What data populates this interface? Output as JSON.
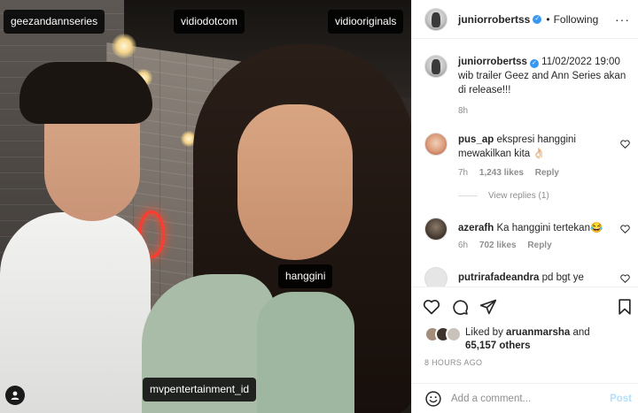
{
  "photo": {
    "tags": {
      "geezandannseries": "geezandannseries",
      "vidiodotcom": "vidiodotcom",
      "vidiooriginals": "vidiooriginals",
      "hanggini": "hanggini",
      "mvpentertainment": "mvpentertainment_id"
    },
    "user_tag_icon": "person-icon"
  },
  "header": {
    "username": "juniorrobertss",
    "separator": "•",
    "follow_label": "Following",
    "more_icon": "more-icon",
    "more_glyph": "···"
  },
  "caption": {
    "username": "juniorrobertss",
    "text": "11/02/2022 19:00 wib trailer Geez and Ann Series akan di release!!!",
    "time": "8h"
  },
  "comments": [
    {
      "username": "pus_ap",
      "text": "ekspresi hanggini mewakilkan kita 👌🏻",
      "time": "7h",
      "likes": "1,243 likes",
      "reply": "Reply",
      "view_replies": "View replies (1)"
    },
    {
      "username": "azerafh",
      "text": "Ka hanggini tertekan😂",
      "time": "6h",
      "likes": "702 likes",
      "reply": "Reply"
    },
    {
      "username": "putrirafadeandra",
      "text": "pd bgt ye"
    }
  ],
  "actions": {
    "icons": [
      "heart-icon",
      "comment-icon",
      "share-icon",
      "bookmark-icon"
    ],
    "liked_prefix": "Liked by",
    "liked_user": "aruanmarsha",
    "liked_and": "and",
    "liked_others": "65,157 others",
    "timestamp": "8 HOURS AGO"
  },
  "add_comment": {
    "emoji_icon": "emoji-icon",
    "placeholder": "Add a comment...",
    "post_label": "Post"
  },
  "colors": {
    "verified": "#3897f0",
    "post_disabled": "#b2dffc",
    "muted": "#8e8e8e"
  }
}
